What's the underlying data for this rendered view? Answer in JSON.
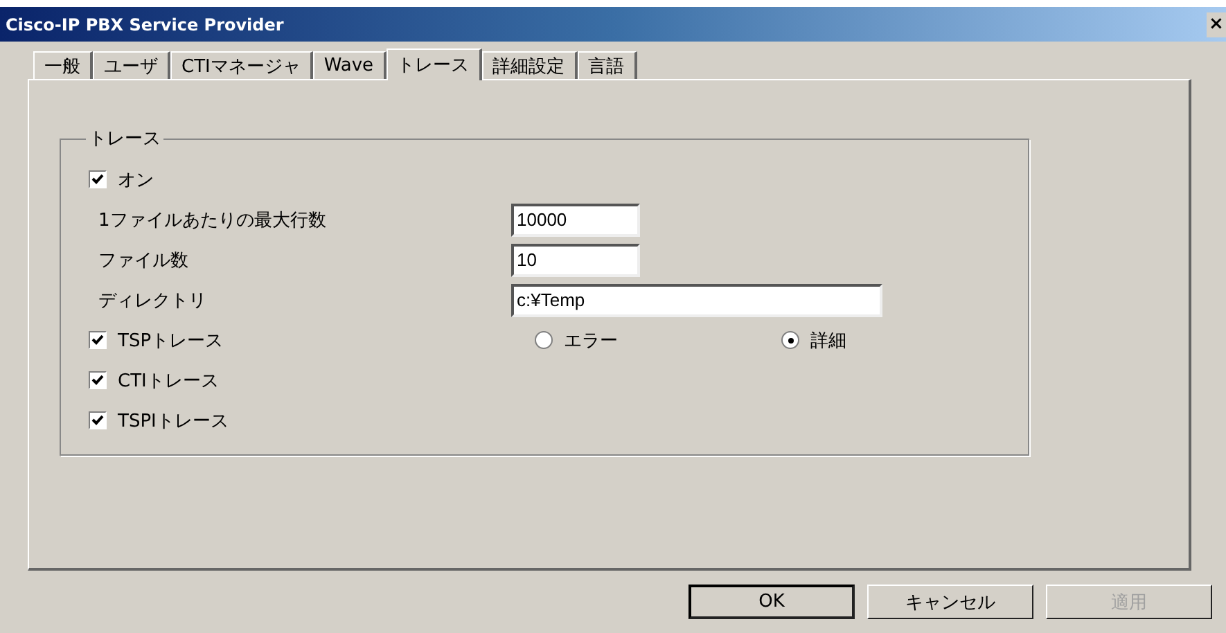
{
  "window": {
    "title": "Cisco-IP PBX Service Provider",
    "close": "×"
  },
  "tabs": [
    {
      "label": "一般",
      "selected": false
    },
    {
      "label": "ユーザ",
      "selected": false
    },
    {
      "label": "CTIマネージャ",
      "selected": false
    },
    {
      "label": "Wave",
      "selected": false
    },
    {
      "label": "トレース",
      "selected": true
    },
    {
      "label": "詳細設定",
      "selected": false
    },
    {
      "label": "言語",
      "selected": false
    }
  ],
  "trace_group": {
    "title": "トレース",
    "rows": [
      {
        "kind": "checkbox",
        "label": "オン",
        "checked": true
      },
      {
        "kind": "number-field",
        "label": "1ファイルあたりの最大行数",
        "value": "10000"
      },
      {
        "kind": "number-field",
        "label": "ファイル数",
        "value": "10"
      },
      {
        "kind": "path-field",
        "label": "ディレクトリ",
        "value": "c:¥Temp"
      },
      {
        "kind": "checkbox-radios",
        "label": "TSPトレース",
        "checked": true,
        "radios": [
          {
            "label": "エラー",
            "selected": false
          },
          {
            "label": "詳細",
            "selected": true
          }
        ]
      },
      {
        "kind": "checkbox",
        "label": "CTIトレース",
        "checked": true
      },
      {
        "kind": "checkbox",
        "label": "TSPIトレース",
        "checked": true
      }
    ]
  },
  "buttons": [
    {
      "label": "OK",
      "default": true,
      "disabled": false
    },
    {
      "label": "キャンセル",
      "default": false,
      "disabled": false
    },
    {
      "label": "適用",
      "default": false,
      "disabled": true
    }
  ]
}
